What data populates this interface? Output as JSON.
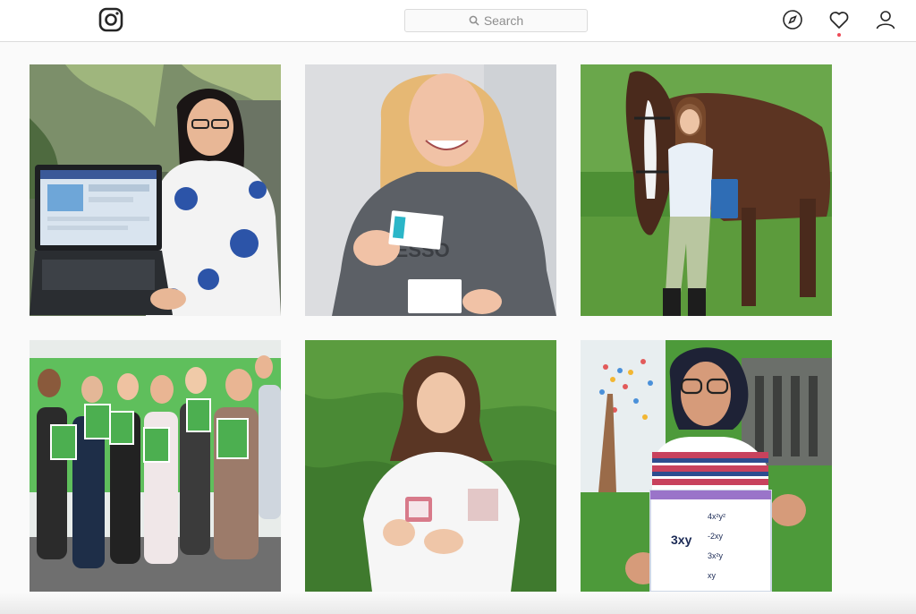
{
  "header": {
    "logo_icon": "instagram-camera-icon",
    "search_placeholder": "Search",
    "search_icon": "magnifier-icon",
    "nav_icons": [
      "compass-icon",
      "heart-icon",
      "person-icon"
    ],
    "notification_color": "#ed4956"
  },
  "feed": {
    "posts": [
      {
        "subject": "woman-with-laptop"
      },
      {
        "subject": "woman-holding-cards"
      },
      {
        "subject": "rider-with-horse"
      },
      {
        "subject": "group-holding-flyers"
      },
      {
        "subject": "girl-holding-card"
      },
      {
        "subject": "woman-holding-worksheet"
      }
    ],
    "worksheet_heading": "3xy",
    "worksheet_rows": [
      "4x²y²",
      "-2xy",
      "3x²y",
      "xy"
    ]
  }
}
